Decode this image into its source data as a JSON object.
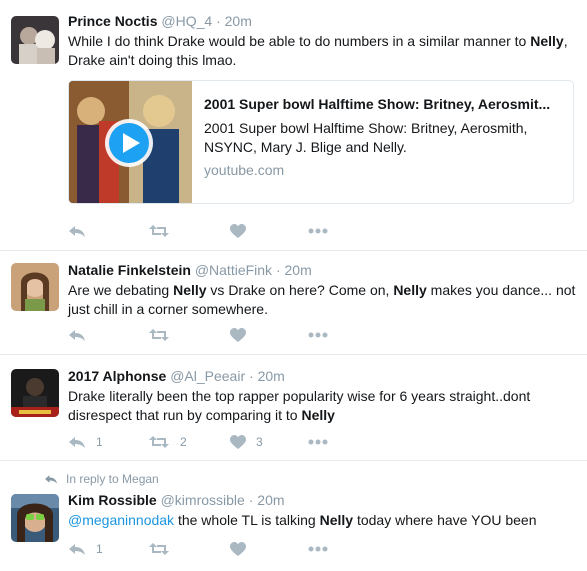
{
  "tweets": [
    {
      "name": "Prince Noctis",
      "handle": "@HQ_4",
      "time": "20m",
      "text_before": "While I do think Drake would be able to do numbers in a similar manner to ",
      "text_bold": "Nelly",
      "text_after": ", Drake ain't doing this lmao.",
      "card": {
        "title": "2001 Super bowl Halftime Show: Britney, Aerosmit...",
        "description": "2001 Super bowl Halftime Show: Britney, Aerosmith, NSYNC, Mary J. Blige and Nelly.",
        "domain": "youtube.com"
      },
      "retweets": "",
      "likes": "",
      "replies": ""
    },
    {
      "name": "Natalie Finkelstein",
      "handle": "@NattieFink",
      "time": "20m",
      "t1": "Are we debating ",
      "b1": "Nelly",
      "t2": " vs Drake on here?  Come on, ",
      "b2": "Nelly",
      "t3": " makes you dance... not just chill in a corner somewhere.",
      "replies": "",
      "retweets": "",
      "likes": ""
    },
    {
      "name": "2017 Alphonse",
      "handle": "@Al_Peeair",
      "time": "20m",
      "text_before": "Drake literally been the top rapper popularity wise for 6 years straight..dont disrespect that run by comparing it to ",
      "text_bold": "Nelly",
      "replies": "1",
      "retweets": "2",
      "likes": "3"
    },
    {
      "reply_context": "In reply to Megan",
      "name": "Kim Rossible",
      "handle": "@kimrossible",
      "time": "20m",
      "mention": "@meganinnodak",
      "t1": " the whole TL is talking ",
      "b1": "Nelly",
      "t2": " today where have YOU been",
      "replies": "1",
      "retweets": "",
      "likes": ""
    }
  ],
  "separator": "·",
  "colors": {
    "name": "#14171a",
    "secondary": "#8899a6",
    "mention": "#1b95e0",
    "icon": "#aab8c2",
    "border": "#e6ecf0"
  },
  "icons": [
    "reply-icon",
    "retweet-icon",
    "like-icon",
    "more-icon",
    "play-icon"
  ]
}
